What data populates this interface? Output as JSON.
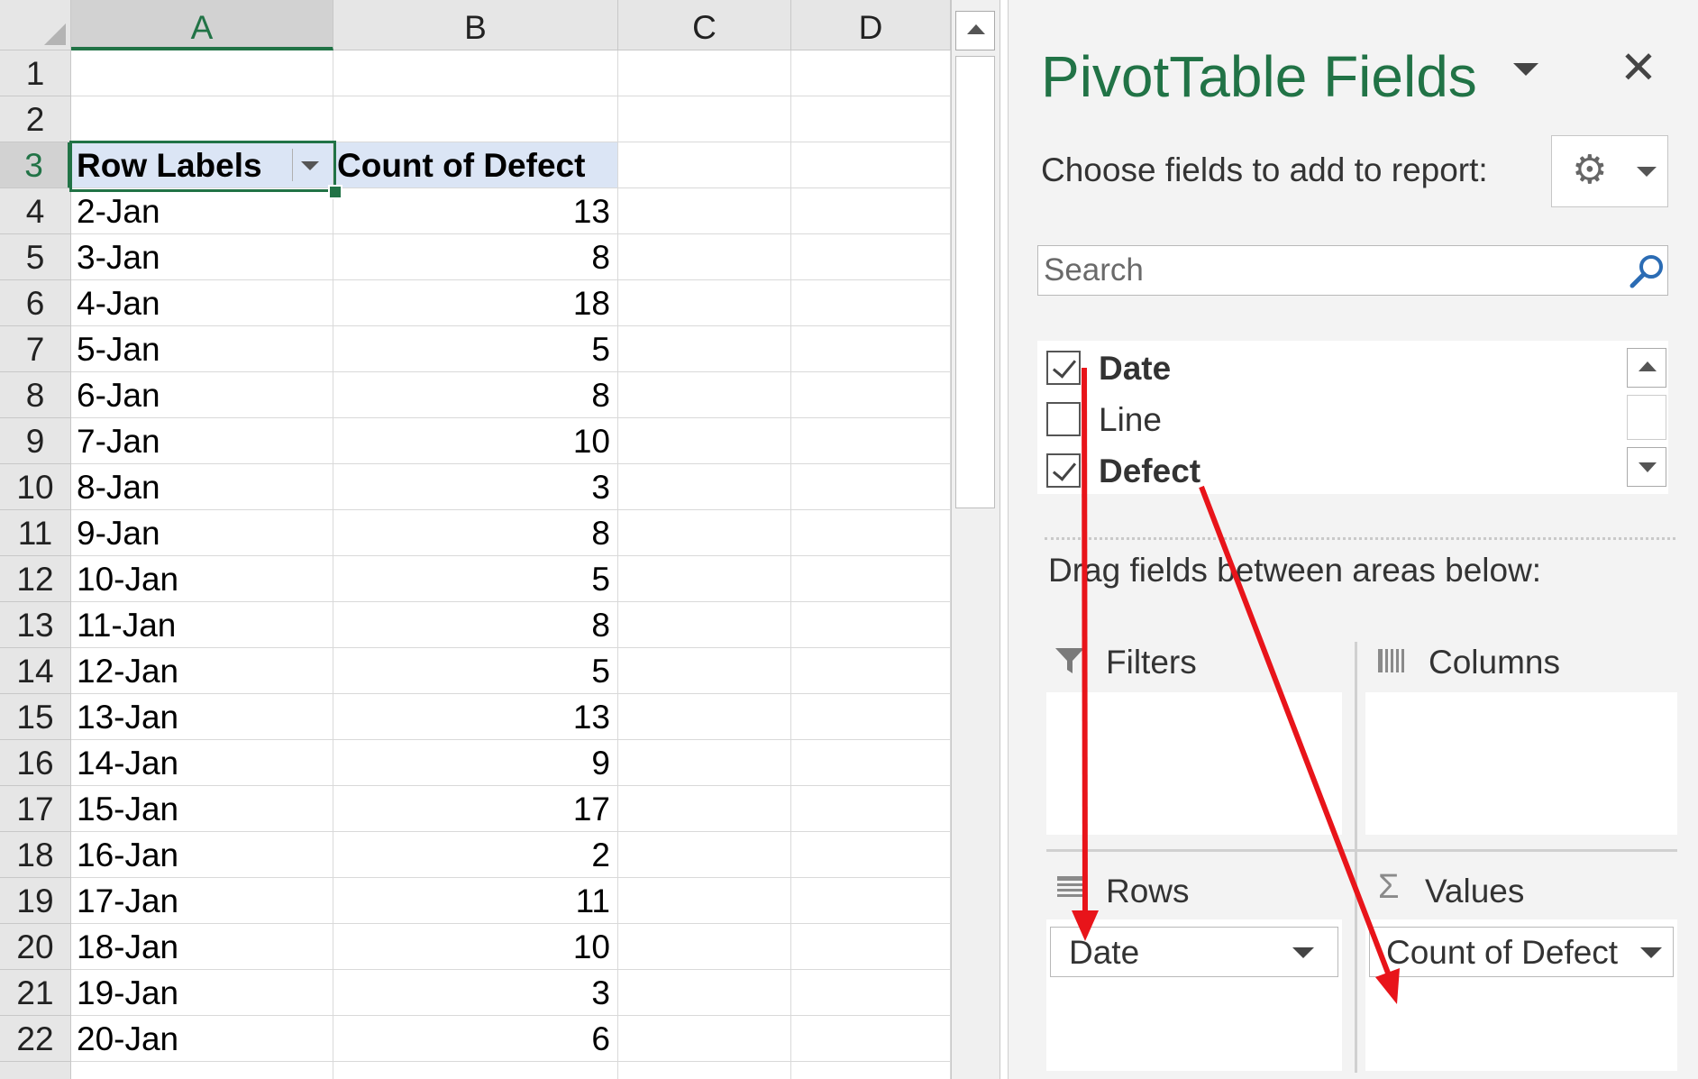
{
  "sheet": {
    "columns": [
      "A",
      "B",
      "C",
      "D"
    ],
    "selected_column": "A",
    "selected_row": "3",
    "rows": [
      {
        "n": "1",
        "a": "",
        "b": ""
      },
      {
        "n": "2",
        "a": "",
        "b": ""
      },
      {
        "n": "3",
        "a": "Row Labels",
        "b": "Count of Defect"
      },
      {
        "n": "4",
        "a": "2-Jan",
        "b": "13"
      },
      {
        "n": "5",
        "a": "3-Jan",
        "b": "8"
      },
      {
        "n": "6",
        "a": "4-Jan",
        "b": "18"
      },
      {
        "n": "7",
        "a": "5-Jan",
        "b": "5"
      },
      {
        "n": "8",
        "a": "6-Jan",
        "b": "8"
      },
      {
        "n": "9",
        "a": "7-Jan",
        "b": "10"
      },
      {
        "n": "10",
        "a": "8-Jan",
        "b": "3"
      },
      {
        "n": "11",
        "a": "9-Jan",
        "b": "8"
      },
      {
        "n": "12",
        "a": "10-Jan",
        "b": "5"
      },
      {
        "n": "13",
        "a": "11-Jan",
        "b": "8"
      },
      {
        "n": "14",
        "a": "12-Jan",
        "b": "5"
      },
      {
        "n": "15",
        "a": "13-Jan",
        "b": "13"
      },
      {
        "n": "16",
        "a": "14-Jan",
        "b": "9"
      },
      {
        "n": "17",
        "a": "15-Jan",
        "b": "17"
      },
      {
        "n": "18",
        "a": "16-Jan",
        "b": "2"
      },
      {
        "n": "19",
        "a": "17-Jan",
        "b": "11"
      },
      {
        "n": "20",
        "a": "18-Jan",
        "b": "10"
      },
      {
        "n": "21",
        "a": "19-Jan",
        "b": "3"
      },
      {
        "n": "22",
        "a": "20-Jan",
        "b": "6"
      }
    ]
  },
  "pane": {
    "title": "PivotTable Fields",
    "close": "✕",
    "choose_label": "Choose fields to add to report:",
    "gear_icon": "gear-icon",
    "search_placeholder": "Search",
    "fields": [
      {
        "label": "Date",
        "checked": true
      },
      {
        "label": "Line",
        "checked": false
      },
      {
        "label": "Defect",
        "checked": true
      }
    ],
    "drag_label": "Drag fields between areas below:",
    "areas": {
      "filters": {
        "label": "Filters",
        "icon": "filter-icon"
      },
      "columns": {
        "label": "Columns",
        "icon": "columns-icon"
      },
      "rows": {
        "label": "Rows",
        "icon": "rows-icon",
        "chip": "Date"
      },
      "values": {
        "label": "Values",
        "icon": "sigma-icon",
        "chip": "Count of Defect"
      }
    }
  },
  "annotation_color": "#e8141a"
}
